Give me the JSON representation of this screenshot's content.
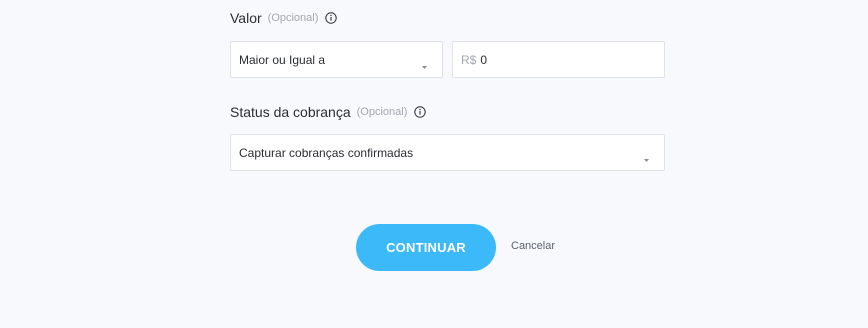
{
  "valor": {
    "label": "Valor",
    "optional": "(Opcional)",
    "operator_value": "Maior ou Igual a",
    "currency_prefix": "R$",
    "amount": "0"
  },
  "status": {
    "label": "Status da cobrança",
    "optional": "(Opcional)",
    "selected": "Capturar cobranças confirmadas"
  },
  "actions": {
    "continue_label": "CONTINUAR",
    "cancel_label": "Cancelar"
  },
  "colors": {
    "accent": "#3cb9f8",
    "background": "#f8f9fc",
    "border": "#dfe2e8",
    "muted": "#a4a7b0"
  },
  "icons": {
    "info": "info-circle-icon",
    "caret": "chevron-down-icon"
  }
}
